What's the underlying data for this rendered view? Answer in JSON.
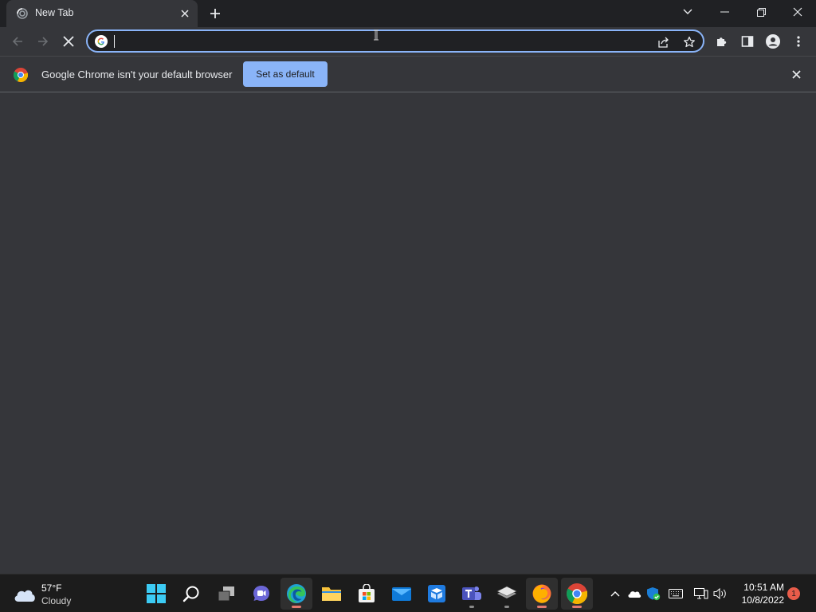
{
  "browser": {
    "tab": {
      "title": "New Tab"
    },
    "toolbar": {
      "address_value": ""
    },
    "infobar": {
      "message": "Google Chrome isn't your default browser",
      "button_label": "Set as default"
    }
  },
  "taskbar": {
    "weather": {
      "temp": "57°F",
      "condition": "Cloudy"
    },
    "apps": [
      "windows-start",
      "search",
      "task-view",
      "chat",
      "edge",
      "file-explorer",
      "microsoft-store",
      "mail",
      "store-app",
      "teams",
      "layers-app",
      "firefox",
      "chrome"
    ],
    "clock": {
      "time": "10:51 AM",
      "date": "10/8/2022"
    },
    "notification_count": "1"
  },
  "colors": {
    "accent": "#8ab4f8",
    "frame": "#202124",
    "toolbar": "#35363a",
    "taskbar": "#1c1c1c",
    "badge": "#e85c4a"
  }
}
